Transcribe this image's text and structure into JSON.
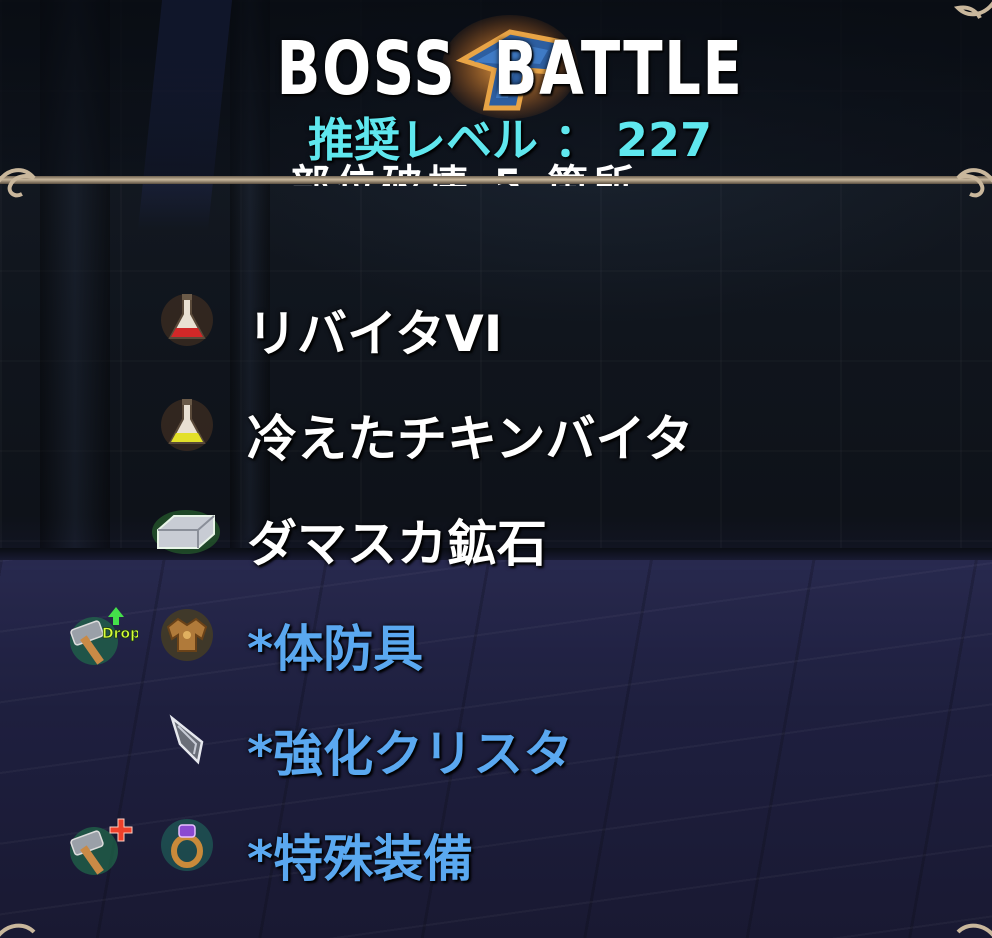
{
  "header": {
    "title": "BOSS  BATTLE",
    "level_label": "推奨レベル ： 227",
    "obscured_line": "部位破壊 5 箇所"
  },
  "items": [
    {
      "label": "リバイタVI",
      "icon": "red-potion-flask-icon",
      "special": false,
      "tool_icon": null
    },
    {
      "label": "冷えたチキンバイタ",
      "icon": "yellow-potion-flask-icon",
      "special": false,
      "tool_icon": null
    },
    {
      "label": "ダマスカ鉱石",
      "icon": "silver-ore-ingot-icon",
      "special": false,
      "tool_icon": null
    },
    {
      "label": "*体防具",
      "icon": "body-armor-icon",
      "special": true,
      "tool_icon": "hammer-drop-up-icon",
      "tool_badge": "Drop"
    },
    {
      "label": "*強化クリスタ",
      "icon": "crystal-shard-icon",
      "special": true,
      "tool_icon": null
    },
    {
      "label": "*特殊装備",
      "icon": "ring-accessory-icon",
      "special": true,
      "tool_icon": "hammer-plus-icon"
    }
  ],
  "colors": {
    "title": "#ffffff",
    "level": "#5fe7ee",
    "normal_item": "#ffffff",
    "special_item": "#5aa8f0",
    "divider": "#c9b79c"
  }
}
